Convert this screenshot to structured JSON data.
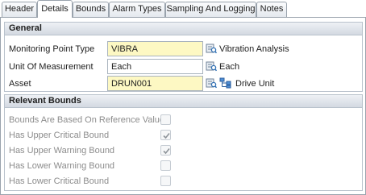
{
  "tabs": [
    {
      "label": "Header"
    },
    {
      "label": "Details"
    },
    {
      "label": "Bounds"
    },
    {
      "label": "Alarm Types"
    },
    {
      "label": "Sampling And Logging"
    },
    {
      "label": "Notes"
    }
  ],
  "active_tab": "Details",
  "general": {
    "title": "General",
    "monitoring_point_type": {
      "label": "Monitoring Point Type",
      "value": "VIBRA",
      "description": "Vibration Analysis",
      "lookup_icon": "lookup-icon"
    },
    "unit_of_measurement": {
      "label": "Unit Of Measurement",
      "value": "Each",
      "description": "Each",
      "lookup_icon": "lookup-icon"
    },
    "asset": {
      "label": "Asset",
      "value": "DRUN001",
      "description": "Drive Unit",
      "lookup_icon": "lookup-icon",
      "tree_icon": "asset-tree-icon"
    }
  },
  "relevant_bounds": {
    "title": "Relevant Bounds",
    "items": [
      {
        "label": "Bounds Are Based On Reference Value",
        "checked": false
      },
      {
        "label": "Has Upper Critical Bound",
        "checked": true
      },
      {
        "label": "Has Upper Warning Bound",
        "checked": true
      },
      {
        "label": "Has Lower Warning Bound",
        "checked": false
      },
      {
        "label": "Has Lower Critical Bound",
        "checked": false
      }
    ]
  },
  "colors": {
    "required_field": "#fdf8c3",
    "group_header": "#d3d9e1",
    "disabled_text": "#8c8c8c"
  }
}
